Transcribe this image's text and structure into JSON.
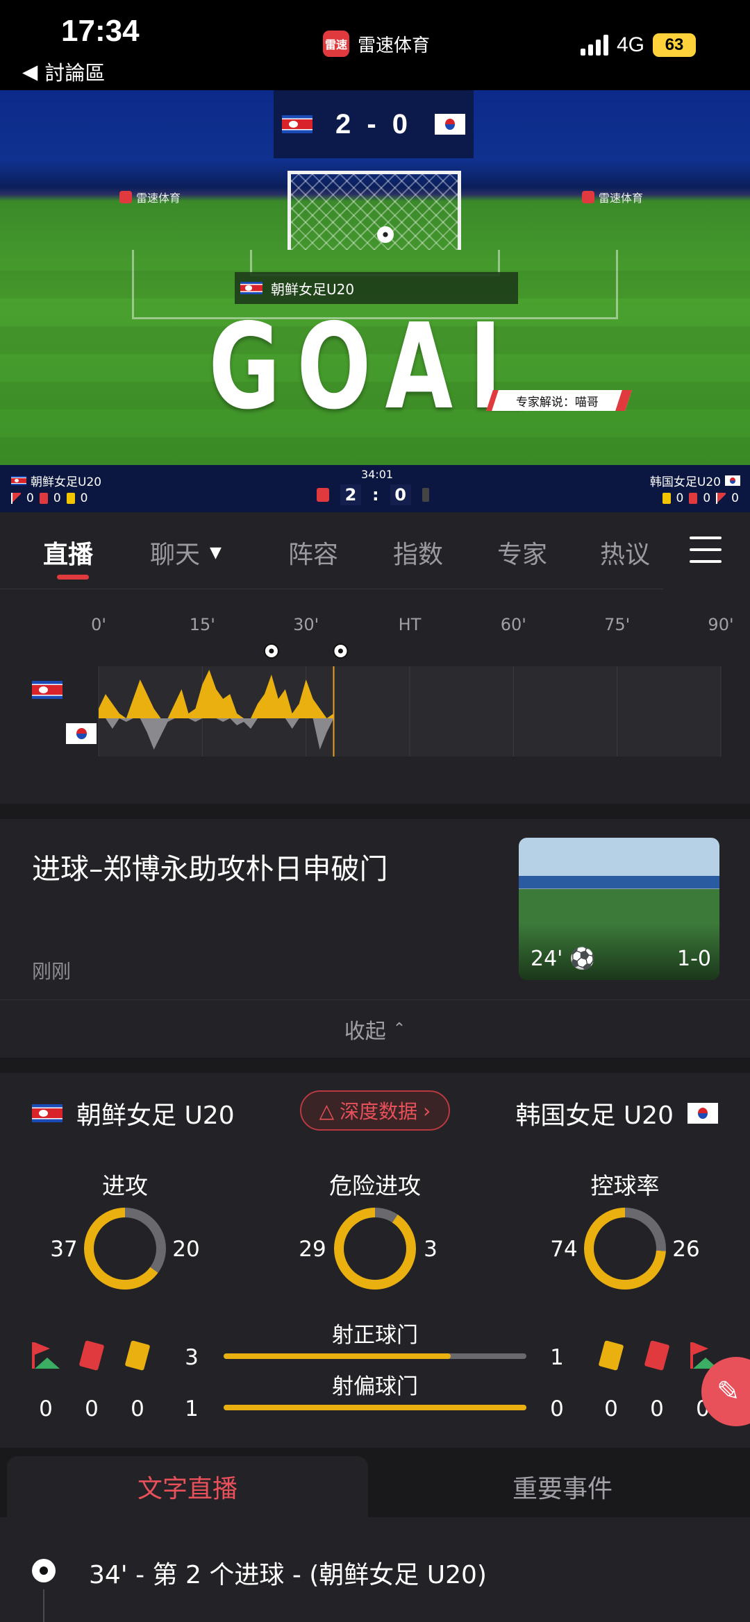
{
  "status_bar": {
    "time": "17:34",
    "back_label": "討論區",
    "app_name": "雷速体育",
    "app_logo_text": "雷速",
    "network": "4G",
    "battery": "63"
  },
  "video": {
    "score_top": "2 - 0",
    "team_banner": "朝鲜女足U20",
    "goal_text": "GOAL",
    "ad_text": "雷速体育",
    "expert_label": "专家解说：喵哥",
    "clock": "34:01",
    "home_team": "朝鲜女足U20",
    "away_team": "韩国女足U20",
    "home_score": "2",
    "away_score": "0",
    "home_corners": "0",
    "home_reds": "0",
    "home_yellows": "0",
    "away_yellows": "0",
    "away_reds": "0",
    "away_corners": "0"
  },
  "tabs": {
    "live": "直播",
    "chat": "聊天",
    "lineup": "阵容",
    "odds": "指数",
    "expert": "专家",
    "hot": "热议"
  },
  "momentum": {
    "ticks": [
      "0'",
      "15'",
      "30'",
      "HT",
      "60'",
      "75'",
      "90'"
    ],
    "current_minute": 34,
    "goal_minutes": [
      25,
      35
    ],
    "home_color": "#e9b010",
    "away_color": "#8a8a8e",
    "home_series": [
      0.2,
      0.5,
      0.3,
      0.1,
      0.0,
      0.4,
      0.8,
      0.5,
      0.2,
      0.0,
      0.0,
      0.3,
      0.6,
      0.1,
      0.2,
      0.7,
      1.0,
      0.6,
      0.4,
      0.5,
      0.1,
      0.0,
      0.0,
      0.3,
      0.5,
      0.9,
      0.4,
      0.6,
      0.1,
      0.3,
      0.8,
      0.4,
      0.2,
      0.0,
      0.1
    ],
    "away_series": [
      0.0,
      0.0,
      0.3,
      0.0,
      0.1,
      0.0,
      0.0,
      0.4,
      0.9,
      0.5,
      0.1,
      0.0,
      0.0,
      0.0,
      0.1,
      0.0,
      0.0,
      0.0,
      0.1,
      0.0,
      0.2,
      0.1,
      0.3,
      0.0,
      0.0,
      0.0,
      0.0,
      0.0,
      0.3,
      0.0,
      0.0,
      0.0,
      0.9,
      0.4,
      0.0
    ]
  },
  "news": {
    "title": "进球–郑博永助攻朴日申破门",
    "time": "刚刚",
    "thumb_minute": "24'",
    "thumb_score": "1-0",
    "collapse_label": "收起"
  },
  "stats": {
    "home_team": "朝鲜女足 U20",
    "away_team": "韩国女足 U20",
    "deep_data_label": "深度数据",
    "attack": {
      "label": "进攻",
      "home": 37,
      "away": 20
    },
    "danger": {
      "label": "危险进攻",
      "home": 29,
      "away": 3
    },
    "possession": {
      "label": "控球率",
      "home": 74,
      "away": 26
    },
    "shots_on": {
      "label": "射正球门",
      "home": 3,
      "away": 1
    },
    "shots_off": {
      "label": "射偏球门",
      "home": 1,
      "away": 0
    },
    "home_corners": "0",
    "home_reds": "0",
    "home_yellows": "0",
    "away_yellows": "0",
    "away_reds": "0",
    "away_corners": "0",
    "accent_color": "#e9b010",
    "track_color": "#6a6a6e"
  },
  "bottom_tabs": {
    "text_live": "文字直播",
    "events": "重要事件"
  },
  "feed": {
    "first_item": "34' - 第 2 个进球 - (朝鲜女足 U20)"
  }
}
